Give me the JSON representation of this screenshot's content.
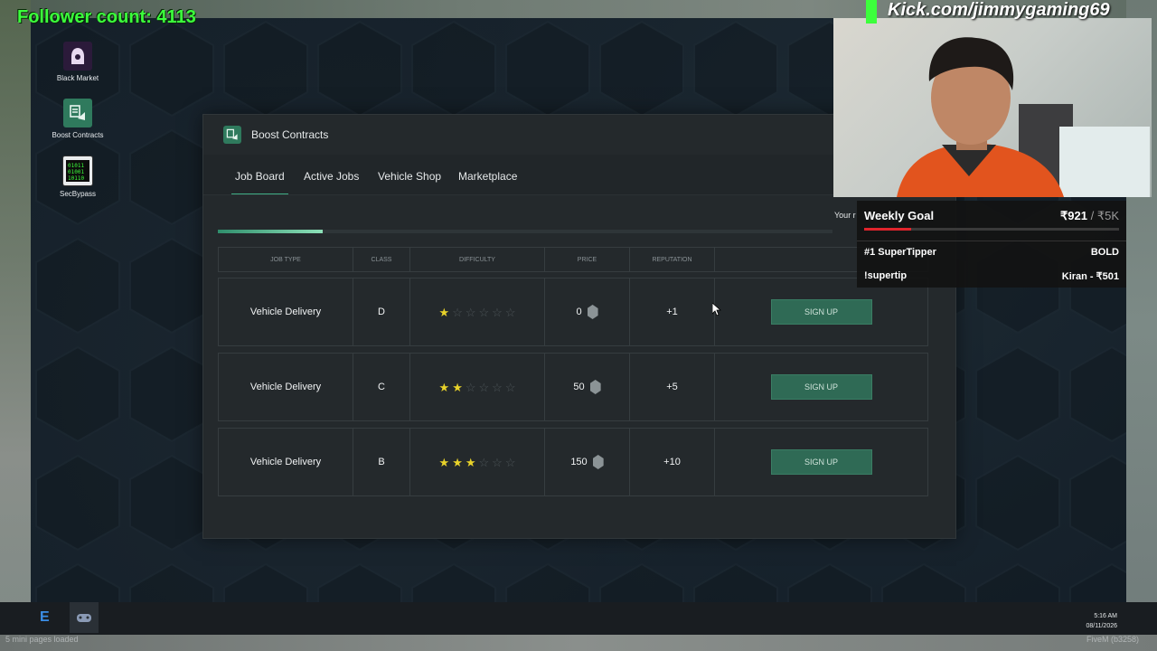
{
  "overlay": {
    "follower_text": "Follower count: 4113",
    "kick_url": "Kick.com/jimmygaming69",
    "goal": {
      "title": "Weekly Goal",
      "current": "₹921",
      "target": " / ₹5K",
      "progress_fraction": 0.184,
      "line1_left": "#1 SuperTipper",
      "line1_right": "BOLD",
      "line2_left": "!supertip",
      "line2_right": "Kiran - ₹501"
    },
    "colors": {
      "follower_green": "#3cff3c",
      "goal_red": "#e0242c"
    }
  },
  "desktop_icons": [
    {
      "label": "Black Market",
      "icon": "hood-icon"
    },
    {
      "label": "Boost Contracts",
      "icon": "contract-icon"
    },
    {
      "label": "SecBypass",
      "icon": "binary-icon"
    }
  ],
  "window": {
    "title": "Boost Contracts",
    "tabs": [
      "Job Board",
      "Active Jobs",
      "Vehicle Shop",
      "Marketplace"
    ],
    "active_tab": "Job Board",
    "reputation_label": "Your r",
    "reputation_progress_fraction": 0.17,
    "columns": [
      "Job Type",
      "Class",
      "Difficulty",
      "Price",
      "Reputation",
      ""
    ],
    "rows": [
      {
        "job_type": "Vehicle Delivery",
        "class": "D",
        "difficulty_stars": 1,
        "max_stars": 6,
        "price": "0",
        "reputation": "+1",
        "action": "SIGN UP"
      },
      {
        "job_type": "Vehicle Delivery",
        "class": "C",
        "difficulty_stars": 2,
        "max_stars": 6,
        "price": "50",
        "reputation": "+5",
        "action": "SIGN UP"
      },
      {
        "job_type": "Vehicle Delivery",
        "class": "B",
        "difficulty_stars": 3,
        "max_stars": 6,
        "price": "150",
        "reputation": "+10",
        "action": "SIGN UP"
      }
    ]
  },
  "taskbar": {
    "time": "5:16 AM",
    "date": "08/11/2026"
  },
  "footer": {
    "left": "5 mini pages loaded",
    "right": "FiveM (b3258)"
  }
}
